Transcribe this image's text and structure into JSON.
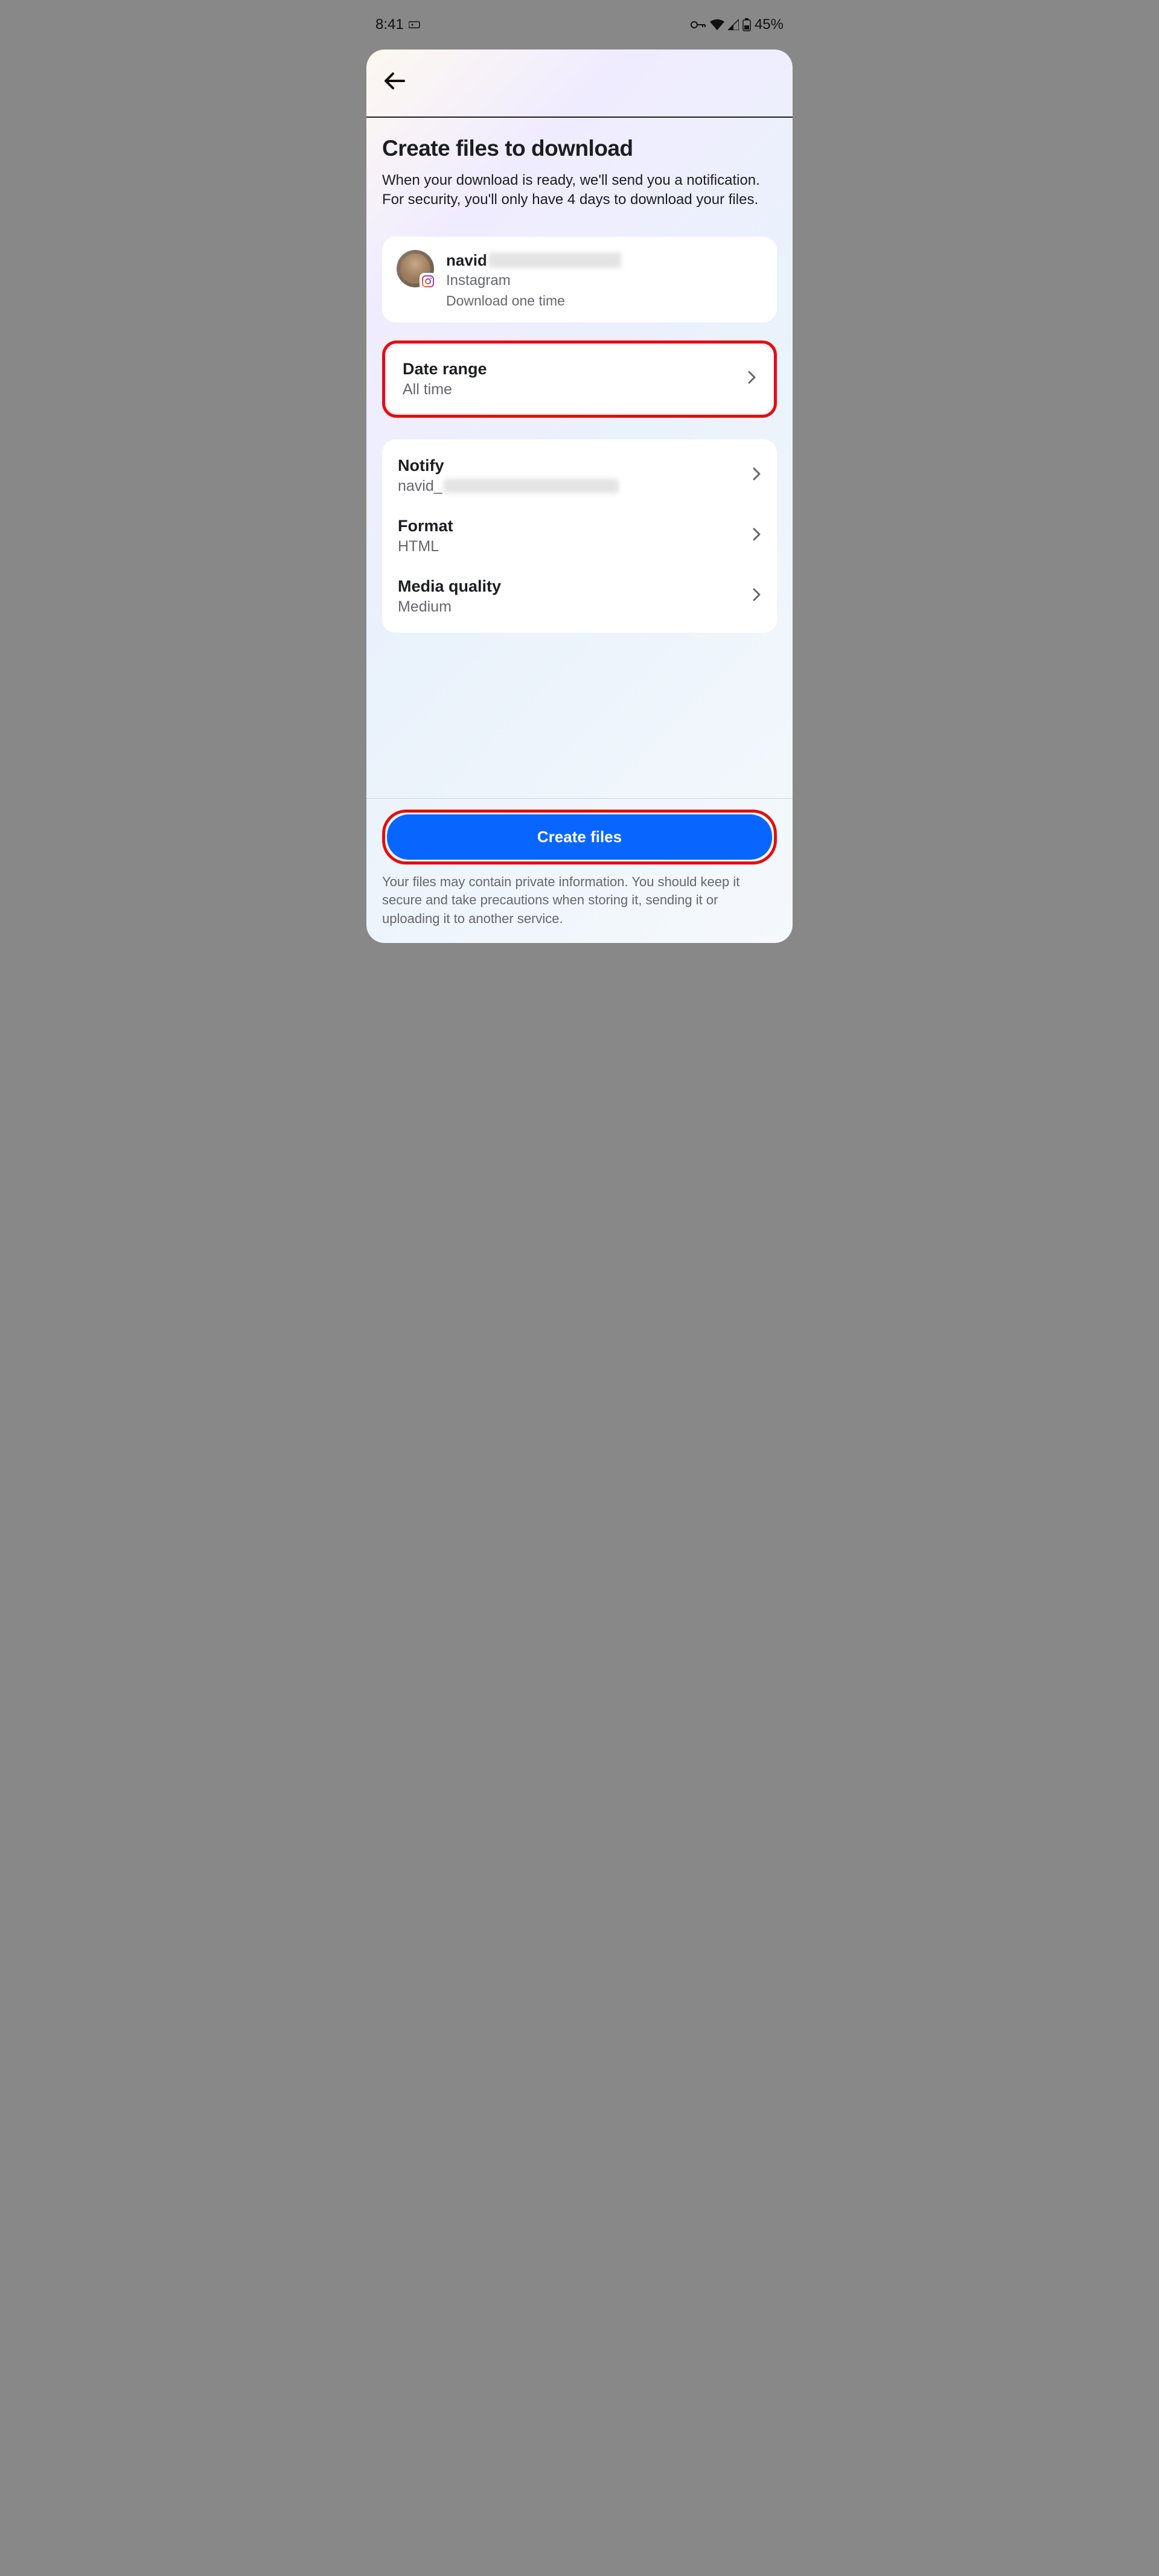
{
  "status_bar": {
    "time": "8:41",
    "battery_percent": "45%"
  },
  "header": {
    "title": "Create files to download",
    "subtitle": "When your download is ready, we'll send you a notification. For security, you'll only have 4 days to download your files."
  },
  "account": {
    "username_prefix": "navid",
    "platform": "Instagram",
    "download_meta": "Download one time"
  },
  "date_range": {
    "label": "Date range",
    "value": "All time"
  },
  "notify": {
    "label": "Notify",
    "value_prefix": "navid_"
  },
  "format": {
    "label": "Format",
    "value": "HTML"
  },
  "media_quality": {
    "label": "Media quality",
    "value": "Medium"
  },
  "cta": {
    "button_label": "Create files",
    "footer_text": "Your files may contain private information. You should keep it secure and take precautions when storing it, sending it or uploading it to another service."
  }
}
